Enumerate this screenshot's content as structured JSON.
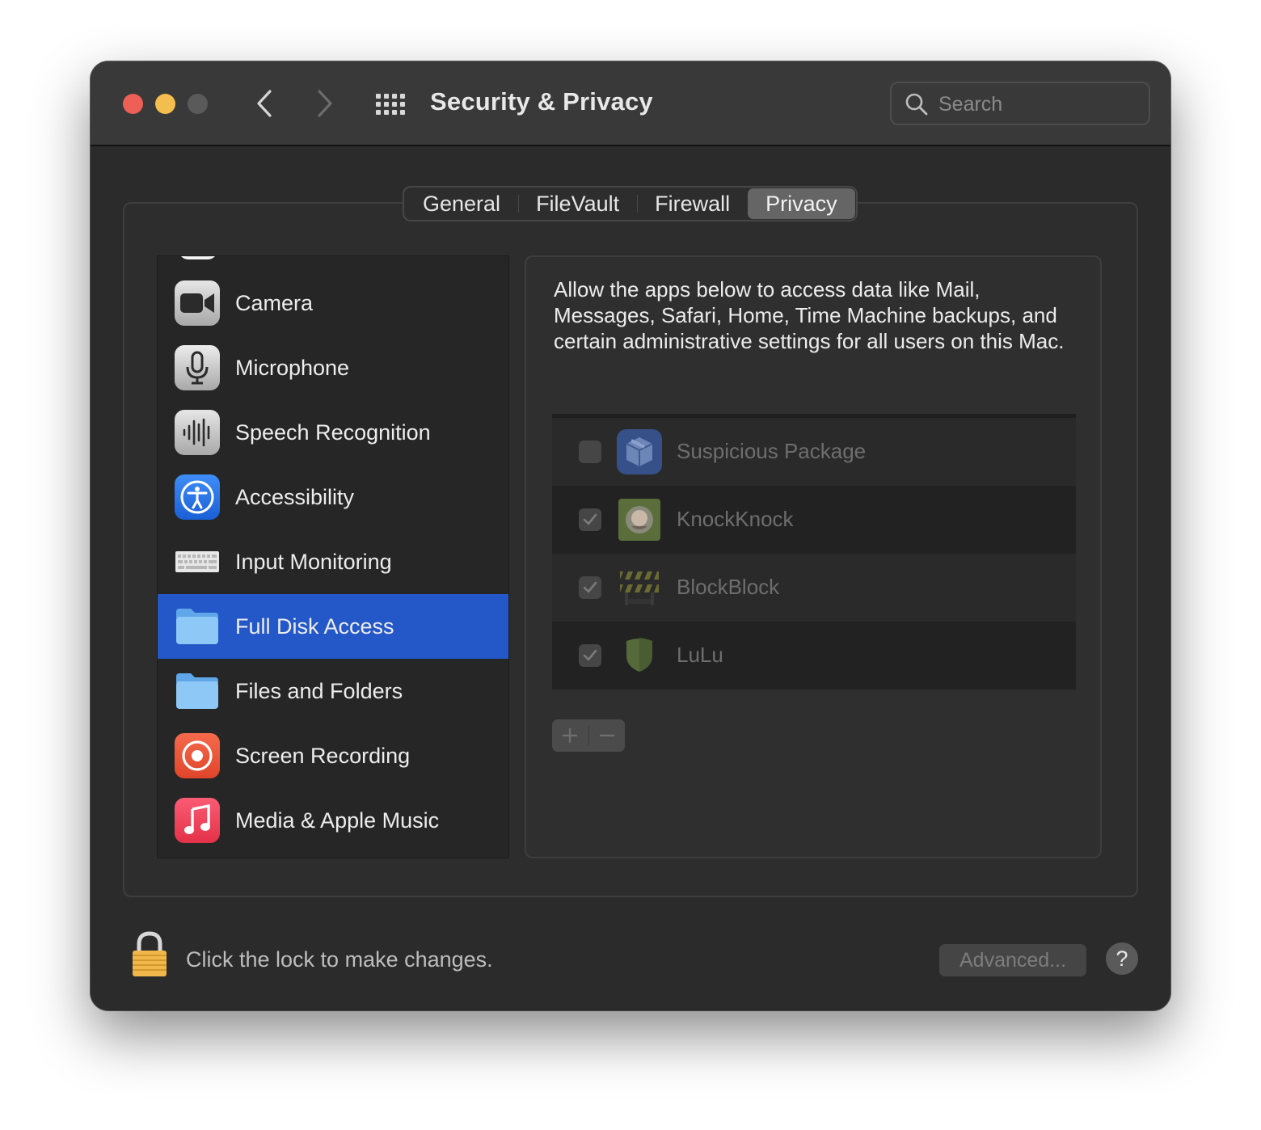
{
  "window": {
    "title": "Security & Privacy"
  },
  "search": {
    "placeholder": "Search"
  },
  "tabs": [
    {
      "label": "General"
    },
    {
      "label": "FileVault"
    },
    {
      "label": "Firewall"
    },
    {
      "label": "Privacy",
      "selected": true
    }
  ],
  "sidebar": {
    "items": [
      {
        "label": "Camera",
        "icon": "camera-icon"
      },
      {
        "label": "Microphone",
        "icon": "microphone-icon"
      },
      {
        "label": "Speech Recognition",
        "icon": "waveform-icon"
      },
      {
        "label": "Accessibility",
        "icon": "accessibility-icon"
      },
      {
        "label": "Input Monitoring",
        "icon": "keyboard-icon"
      },
      {
        "label": "Full Disk Access",
        "icon": "folder-icon",
        "selected": true
      },
      {
        "label": "Files and Folders",
        "icon": "folder-icon"
      },
      {
        "label": "Screen Recording",
        "icon": "record-icon"
      },
      {
        "label": "Media & Apple Music",
        "icon": "music-note-icon"
      }
    ]
  },
  "panel": {
    "description": "Allow the apps below to access data like Mail, Messages, Safari, Home, Time Machine backups, and certain administrative settings for all users on this Mac.",
    "apps": [
      {
        "name": "Suspicious Package",
        "checked": false,
        "icon": "package-icon"
      },
      {
        "name": "KnockKnock",
        "checked": true,
        "icon": "knockknock-icon"
      },
      {
        "name": "BlockBlock",
        "checked": true,
        "icon": "barricade-icon"
      },
      {
        "name": "LuLu",
        "checked": true,
        "icon": "shield-icon"
      }
    ]
  },
  "footer": {
    "lock_text": "Click the lock to make changes.",
    "advanced_label": "Advanced...",
    "help_label": "?"
  },
  "colors": {
    "selection": "#2458c8",
    "close": "#ed5f57",
    "minimize": "#f4bd4f"
  }
}
